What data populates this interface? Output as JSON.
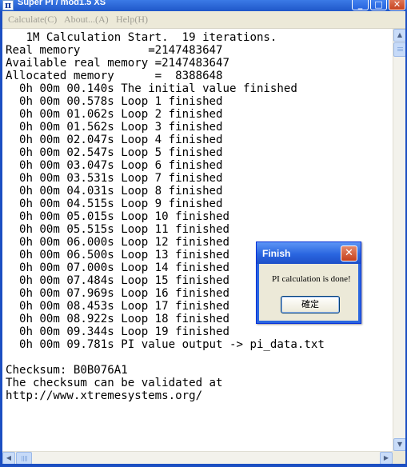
{
  "window": {
    "title": "Super PI / mod1.5 XS",
    "icon": "pi-icon",
    "caption_buttons": {
      "minimize": "_",
      "maximize": "□",
      "close": "✕"
    }
  },
  "menu": {
    "calculate": "Calculate(C)",
    "about": "About...(A)",
    "help": "Help(H)"
  },
  "console": {
    "lines": [
      "   1M Calculation Start.  19 iterations.",
      "Real memory          =2147483647",
      "Available real memory =2147483647",
      "Allocated memory      =  8388648",
      "  0h 00m 00.140s The initial value finished",
      "  0h 00m 00.578s Loop 1 finished",
      "  0h 00m 01.062s Loop 2 finished",
      "  0h 00m 01.562s Loop 3 finished",
      "  0h 00m 02.047s Loop 4 finished",
      "  0h 00m 02.547s Loop 5 finished",
      "  0h 00m 03.047s Loop 6 finished",
      "  0h 00m 03.531s Loop 7 finished",
      "  0h 00m 04.031s Loop 8 finished",
      "  0h 00m 04.515s Loop 9 finished",
      "  0h 00m 05.015s Loop 10 finished",
      "  0h 00m 05.515s Loop 11 finished",
      "  0h 00m 06.000s Loop 12 finished",
      "  0h 00m 06.500s Loop 13 finished",
      "  0h 00m 07.000s Loop 14 finished",
      "  0h 00m 07.484s Loop 15 finished",
      "  0h 00m 07.969s Loop 16 finished",
      "  0h 00m 08.453s Loop 17 finished",
      "  0h 00m 08.922s Loop 18 finished",
      "  0h 00m 09.344s Loop 19 finished",
      "  0h 00m 09.781s PI value output -> pi_data.txt",
      "",
      "Checksum: B0B076A1",
      "The checksum can be validated at",
      "http://www.xtremesystems.org/"
    ]
  },
  "dialog": {
    "title": "Finish",
    "message": "PI calculation is done!",
    "ok_label": "確定",
    "close_glyph": "✕"
  },
  "scrollbars": {
    "up_glyph": "▲",
    "down_glyph": "▼",
    "left_glyph": "◀",
    "right_glyph": "▶"
  }
}
